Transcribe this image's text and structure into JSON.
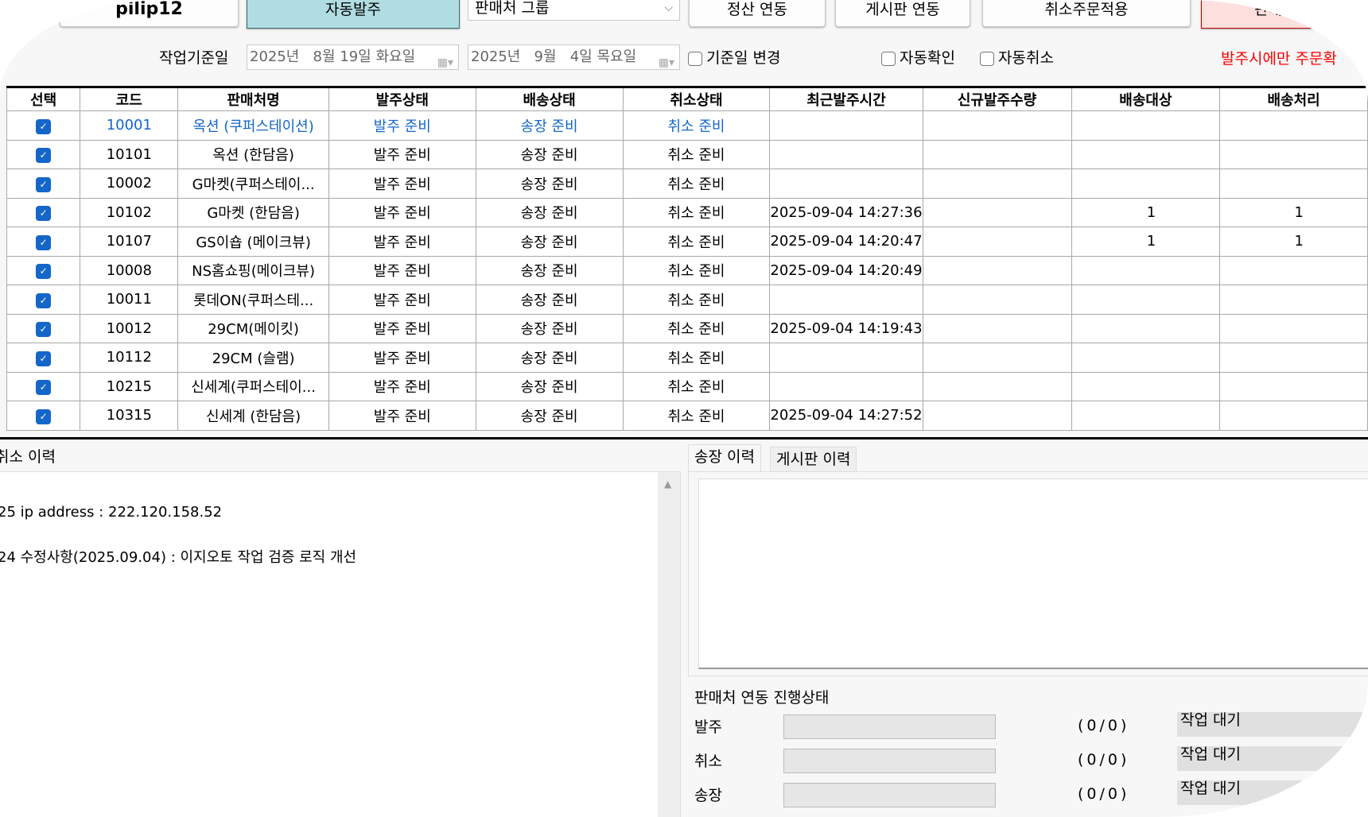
{
  "toolbar": {
    "user_label": "pilip12",
    "auto_order": "자동발주",
    "vendor_group": "판매처 그룹",
    "settlement": "정산 연동",
    "board": "게시판 연동",
    "cancel_apply": "취소주문적용",
    "vendor_partial": "판매..."
  },
  "filters": {
    "work_date_label": "작업기준일",
    "date_from": "2025년   8월 19일 화요일",
    "date_to": "2025년   9월   4일 목요일",
    "change_date": "기준일 변경",
    "auto_confirm": "자동확인",
    "auto_cancel": "자동취소",
    "notice": "발주시에만 주문확"
  },
  "table": {
    "headers": [
      "선택",
      "코드",
      "판매처명",
      "발주상태",
      "배송상태",
      "취소상태",
      "최근발주시간",
      "신규발주수량",
      "배송대상",
      "배송처리"
    ],
    "rows": [
      [
        "10001",
        "옥션 (쿠퍼스테이션)",
        "발주 준비",
        "송장 준비",
        "취소 준비",
        "",
        "",
        "",
        ""
      ],
      [
        "10101",
        "옥션 (한담음)",
        "발주 준비",
        "송장 준비",
        "취소 준비",
        "",
        "",
        "",
        ""
      ],
      [
        "10002",
        "G마켓(쿠퍼스테이...",
        "발주 준비",
        "송장 준비",
        "취소 준비",
        "",
        "",
        "",
        ""
      ],
      [
        "10102",
        "G마켓 (한담음)",
        "발주 준비",
        "송장 준비",
        "취소 준비",
        "2025-09-04 14:27:36",
        "",
        "1",
        "1"
      ],
      [
        "10107",
        "GS이숍 (메이크뷰)",
        "발주 준비",
        "송장 준비",
        "취소 준비",
        "2025-09-04 14:20:47",
        "",
        "1",
        "1"
      ],
      [
        "10008",
        "NS홈쇼핑(메이크뷰)",
        "발주 준비",
        "송장 준비",
        "취소 준비",
        "2025-09-04 14:20:49",
        "",
        "",
        ""
      ],
      [
        "10011",
        "롯데ON(쿠퍼스테...",
        "발주 준비",
        "송장 준비",
        "취소 준비",
        "",
        "",
        "",
        ""
      ],
      [
        "10012",
        "29CM(메이킷)",
        "발주 준비",
        "송장 준비",
        "취소 준비",
        "2025-09-04 14:19:43",
        "",
        "",
        ""
      ],
      [
        "10112",
        "29CM (슬램)",
        "발주 준비",
        "송장 준비",
        "취소 준비",
        "",
        "",
        "",
        ""
      ],
      [
        "10215",
        "신세계(쿠퍼스테이...",
        "발주 준비",
        "송장 준비",
        "취소 준비",
        "",
        "",
        "",
        ""
      ],
      [
        "10315",
        "신세계 (한담음)",
        "발주 준비",
        "송장 준비",
        "취소 준비",
        "2025-09-04 14:27:52",
        "",
        "",
        ""
      ]
    ]
  },
  "left_panel": {
    "title": "취소 이력",
    "log": [
      "25 ip address : 222.120.158.52",
      "24 수정사항(2025.09.04) : 이지오토 작업 검증 로직 개선"
    ]
  },
  "right_panel": {
    "tabs": [
      "송장 이력",
      "게시판 이력"
    ],
    "progress_title": "판매처 연동 진행상태",
    "progress": [
      {
        "label": "발주",
        "count": "(0/0)",
        "state": "작업 대기",
        "value": 0
      },
      {
        "label": "취소",
        "count": "(0/0)",
        "state": "작업 대기",
        "value": 0
      },
      {
        "label": "송장",
        "count": "(0/0)",
        "state": "작업 대기",
        "value": 0
      }
    ]
  },
  "colors": {
    "accent": "#1466c8",
    "auto_order_bg": "#b0dde2",
    "notice": "#ff0000"
  }
}
